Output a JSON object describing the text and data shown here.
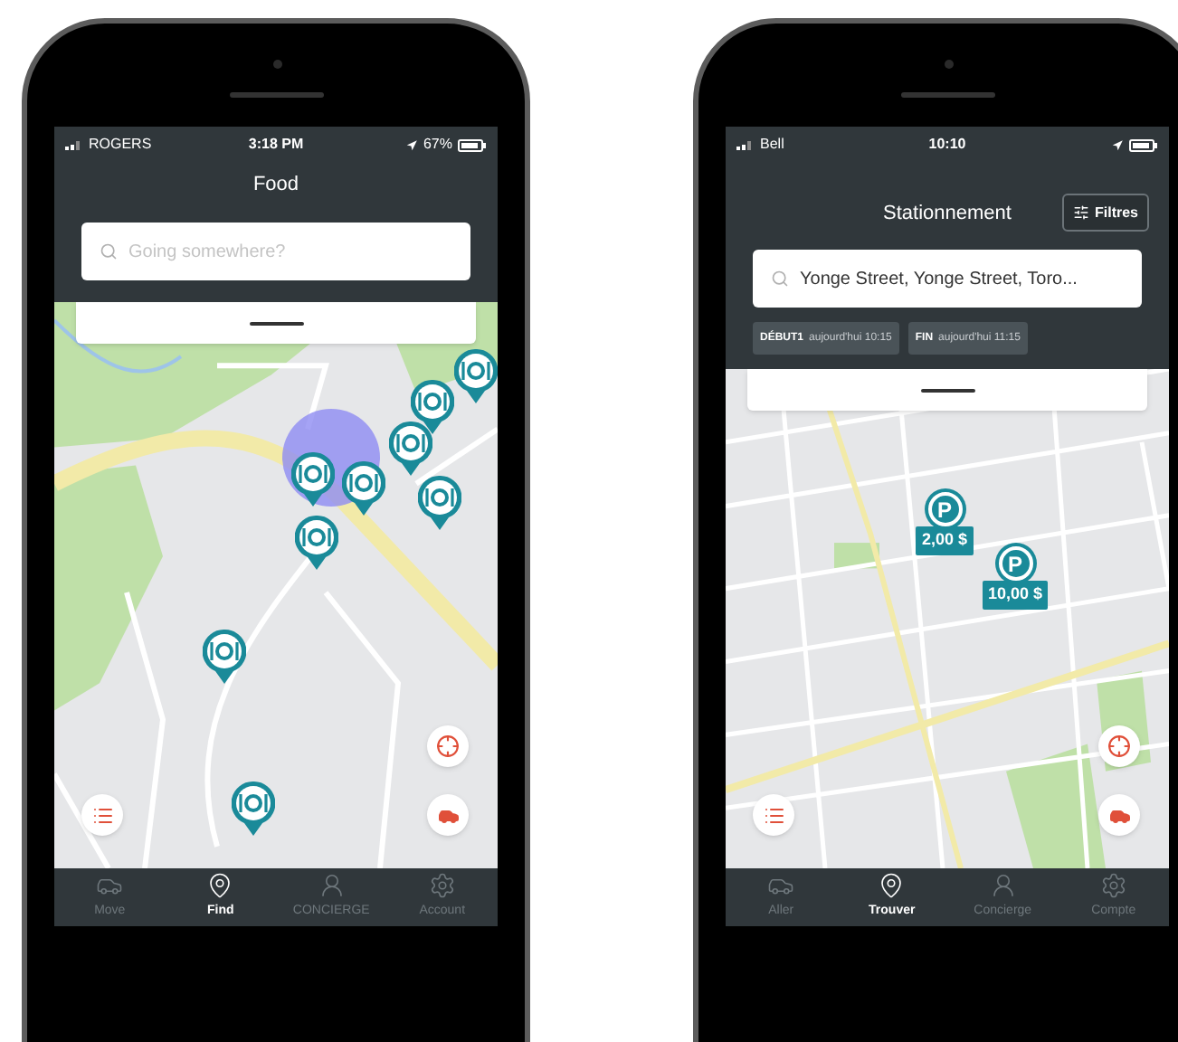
{
  "phones": [
    {
      "status_bar": {
        "carrier": "ROGERS",
        "time": "3:18 PM",
        "battery": "67%"
      },
      "header": {
        "title": "Food"
      },
      "search": {
        "placeholder": "Going somewhere?"
      },
      "map": {
        "kind": "picture",
        "user_location": true,
        "markers": [
          {
            "kind": "food"
          },
          {
            "kind": "food"
          },
          {
            "kind": "food"
          },
          {
            "kind": "food"
          },
          {
            "kind": "food"
          },
          {
            "kind": "food"
          },
          {
            "kind": "food"
          },
          {
            "kind": "food"
          },
          {
            "kind": "food"
          }
        ]
      },
      "tabs": [
        {
          "label": "Move",
          "selected": false
        },
        {
          "label": "Find",
          "selected": true
        },
        {
          "label": "CONCIERGE",
          "selected": false
        },
        {
          "label": "Account",
          "selected": false
        }
      ]
    },
    {
      "status_bar": {
        "carrier": "Bell",
        "time": "10:10"
      },
      "header": {
        "title": "Stationnement"
      },
      "filter_button": {
        "label": "Filtres"
      },
      "search": {
        "value": "Yonge Street, Yonge Street, Toro..."
      },
      "time_chips": [
        {
          "label": "DÉBUT1",
          "value": "aujourd'hui 10:15"
        },
        {
          "label": "FIN",
          "value": "aujourd'hui 11:15"
        }
      ],
      "map": {
        "kind": "picture",
        "markers": [
          {
            "kind": "parking",
            "label": "P",
            "price": "2,00 $"
          },
          {
            "kind": "parking",
            "label": "P",
            "price": "10,00 $"
          }
        ]
      },
      "tabs": [
        {
          "label": "Aller",
          "selected": false
        },
        {
          "label": "Trouver",
          "selected": true
        },
        {
          "label": "Concierge",
          "selected": false
        },
        {
          "label": "Compte",
          "selected": false
        }
      ]
    }
  ]
}
